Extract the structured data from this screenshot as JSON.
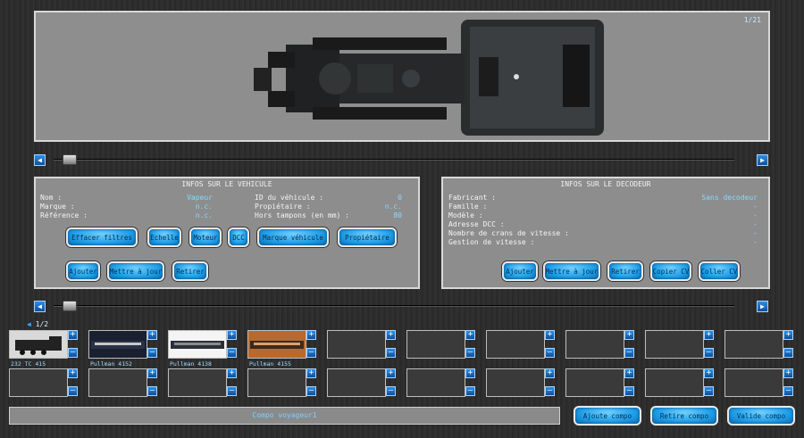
{
  "viewer": {
    "counter": "1/21"
  },
  "vehicle_panel": {
    "title": "INFOS SUR LE VEHICULE",
    "fields_left": [
      {
        "label": "Nom :",
        "value": "Vapeur"
      },
      {
        "label": "Marque :",
        "value": "n.c."
      },
      {
        "label": "Référence :",
        "value": "n.c."
      }
    ],
    "fields_right": [
      {
        "label": "ID du véhicule :",
        "value": "0"
      },
      {
        "label": "Propiétaire :",
        "value": "n.c."
      },
      {
        "label": "Hors tampons (en mm) :",
        "value": "80"
      }
    ],
    "filter_buttons": [
      "Effacer filtres",
      "Echelle",
      "Moteur",
      "DCC",
      "Marque véhicule",
      "Propiétaire"
    ],
    "action_buttons": [
      "Ajouter",
      "Mettre à jour",
      "Retirer"
    ]
  },
  "decoder_panel": {
    "title": "INFOS SUR LE DECODEUR",
    "fields": [
      {
        "label": "Fabricant :",
        "value": "Sans decodeur"
      },
      {
        "label": "Famille :",
        "value": "-"
      },
      {
        "label": "Modèle :",
        "value": "-"
      },
      {
        "label": "Adresse DCC :",
        "value": "-"
      },
      {
        "label": "Nombre de crans de vitesse :",
        "value": "-"
      },
      {
        "label": "Gestion de vitesse :",
        "value": "-"
      }
    ],
    "action_buttons": [
      "Ajouter",
      "Mettre à jour",
      "Retirer",
      "Copier CV",
      "Coller CV"
    ]
  },
  "pager": "1/2",
  "slots_row1": [
    {
      "name": "232 TC 415",
      "kind": "loco"
    },
    {
      "name": "Pullman 4152",
      "kind": "pullman-dark"
    },
    {
      "name": "Pullman 4138",
      "kind": "pullman-white"
    },
    {
      "name": "Pullman 4155",
      "kind": "pullman-orange"
    },
    {
      "name": "",
      "kind": "empty"
    },
    {
      "name": "",
      "kind": "empty"
    },
    {
      "name": "",
      "kind": "empty"
    },
    {
      "name": "",
      "kind": "empty"
    },
    {
      "name": "",
      "kind": "empty"
    },
    {
      "name": "",
      "kind": "empty"
    }
  ],
  "slots_row2_count": 10,
  "slot_controls": {
    "plus": "+",
    "minus": "–"
  },
  "compo_name": "Compo voyageur1",
  "bottom_buttons": [
    "Ajoute compo",
    "Retire compo",
    "Valide compo"
  ],
  "icons": {
    "left": "◀",
    "right": "▶",
    "pager": "◀"
  }
}
